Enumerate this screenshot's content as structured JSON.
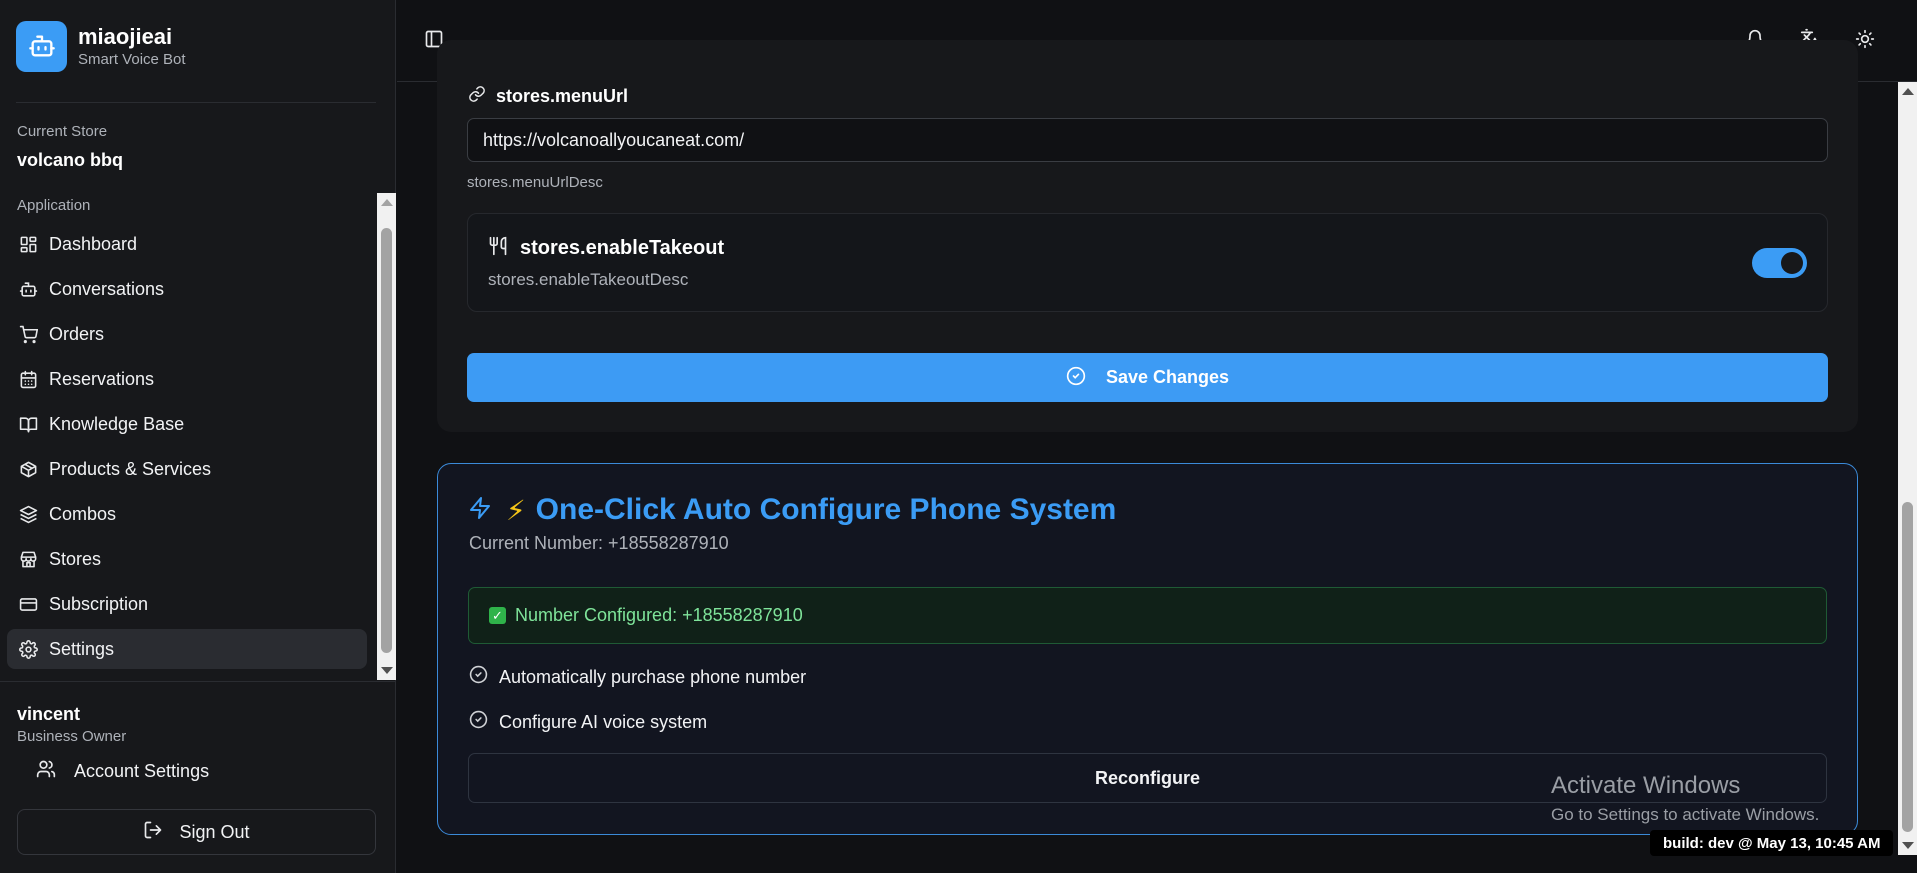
{
  "brand": {
    "name": "miaojieai",
    "subtitle": "Smart Voice Bot"
  },
  "store": {
    "label": "Current Store",
    "name": "volcano bbq"
  },
  "nav": {
    "group_label": "Application",
    "items": [
      {
        "label": "Dashboard",
        "icon": "dashboard-icon"
      },
      {
        "label": "Conversations",
        "icon": "bot-icon"
      },
      {
        "label": "Orders",
        "icon": "cart-icon"
      },
      {
        "label": "Reservations",
        "icon": "calendar-icon"
      },
      {
        "label": "Knowledge Base",
        "icon": "book-icon"
      },
      {
        "label": "Products & Services",
        "icon": "package-icon"
      },
      {
        "label": "Combos",
        "icon": "layers-icon"
      },
      {
        "label": "Stores",
        "icon": "store-icon"
      },
      {
        "label": "Subscription",
        "icon": "credit-card-icon"
      },
      {
        "label": "Settings",
        "icon": "gear-icon",
        "active": true
      }
    ]
  },
  "user": {
    "name": "vincent",
    "role": "Business Owner",
    "account_label": "Account Settings",
    "signout_label": "Sign Out"
  },
  "settings": {
    "menu_url_title": "stores.menuUrl",
    "menu_url_value": "https://volcanoallyoucaneat.com/",
    "menu_url_desc": "stores.menuUrlDesc",
    "takeout_title": "stores.enableTakeout",
    "takeout_desc": "stores.enableTakeoutDesc",
    "takeout_enabled": true,
    "save_label": "Save Changes"
  },
  "auto_config": {
    "emoji": "⚡",
    "title": "One-Click Auto Configure Phone System",
    "current_number": "Current Number: +18558287910",
    "configured_text": "Number Configured: +18558287910",
    "steps": [
      "Automatically purchase phone number",
      "Configure AI voice system"
    ],
    "reconfigure_label": "Reconfigure"
  },
  "watermark": {
    "title": "Activate Windows",
    "subtitle": "Go to Settings to activate Windows."
  },
  "build": "build: dev @ May 13, 10:45 AM",
  "colors": {
    "accent": "#3b9cf5",
    "success": "#2fb34a",
    "background": "#101114",
    "sidebar": "#17181b"
  }
}
